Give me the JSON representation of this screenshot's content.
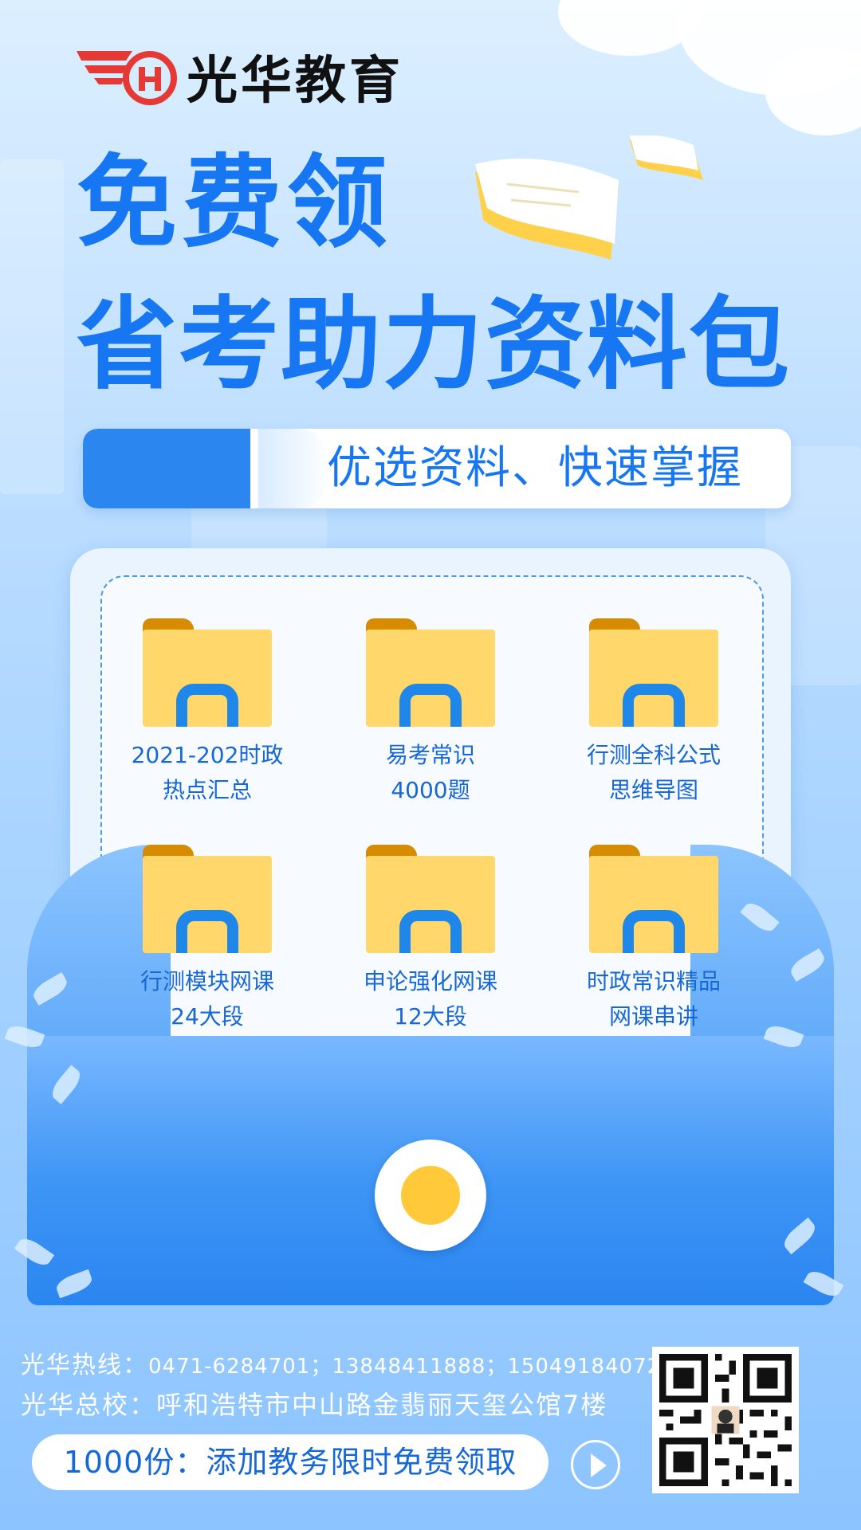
{
  "brand": {
    "name": "光华教育"
  },
  "headline": {
    "line1": "免费领",
    "line2": "省考助力资料包"
  },
  "tagline": "优选资料、快速掌握",
  "resources": [
    {
      "line1": "2021-202时政",
      "line2": "热点汇总"
    },
    {
      "line1": "易考常识",
      "line2": "4000题"
    },
    {
      "line1": "行测全科公式",
      "line2": "思维导图"
    },
    {
      "line1": "行测模块网课",
      "line2": "24大段"
    },
    {
      "line1": "申论强化网课",
      "line2": "12大段"
    },
    {
      "line1": "时政常识精品",
      "line2": "网课串讲"
    }
  ],
  "footer": {
    "hotline_label": "光华热线：",
    "hotline_numbers": "0471-6284701；13848411888；15049184072",
    "address_label": "光华总校：",
    "address": "呼和浩特市中山路金翡丽天玺公馆7楼",
    "cta": "1000份：添加教务限时免费领取"
  },
  "icons": {
    "logo": "guanghua-logo-icon",
    "folder": "folder-icon",
    "arrow": "arrow-right-icon",
    "qr": "qr-code-icon",
    "seal": "envelope-seal-icon"
  },
  "colors": {
    "accent": "#1777f2",
    "folder": "#ffd76a",
    "folder_tab": "#d68b00",
    "seal": "#ffc93a",
    "logo_red": "#e53935"
  }
}
